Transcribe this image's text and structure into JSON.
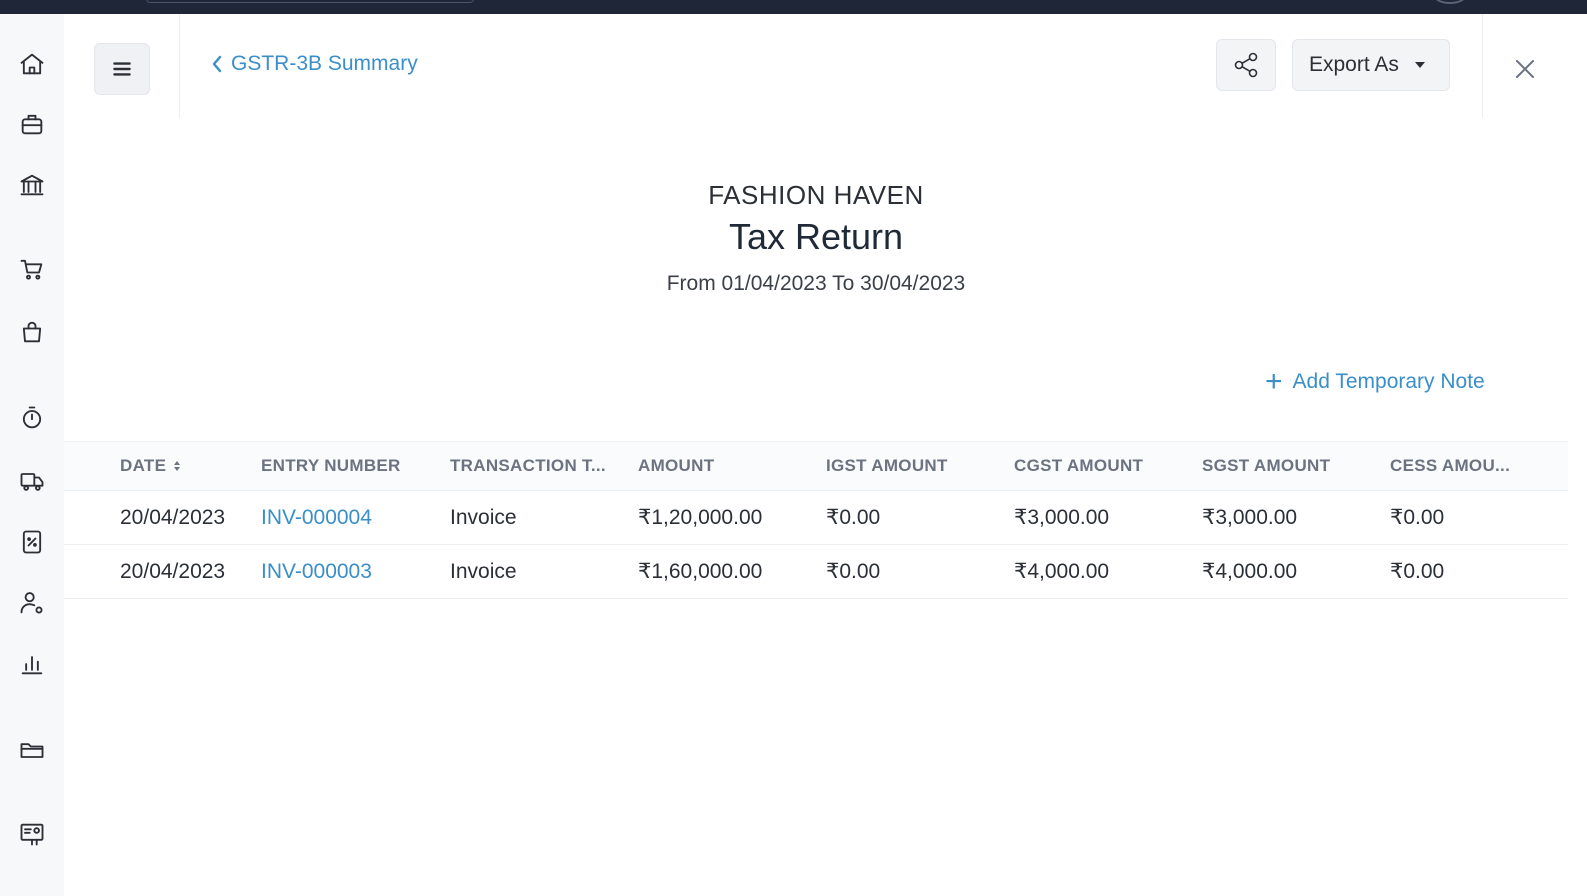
{
  "header": {
    "back_label": "GSTR-3B Summary",
    "export_label": "Export As"
  },
  "sidebar": {
    "icons": [
      "home-icon",
      "briefcase-icon",
      "bank-icon",
      "cart-icon",
      "shopping-bag-icon",
      "timer-icon",
      "delivery-truck-icon",
      "tax-document-icon",
      "user-settings-icon",
      "bar-chart-icon",
      "folder-icon",
      "settings-card-icon"
    ]
  },
  "report": {
    "company": "FASHION HAVEN",
    "title": "Tax Return",
    "period": "From 01/04/2023 To 30/04/2023",
    "add_note_label": "Add Temporary Note"
  },
  "table": {
    "columns": [
      "DATE",
      "ENTRY NUMBER",
      "TRANSACTION T...",
      "AMOUNT",
      "IGST AMOUNT",
      "CGST AMOUNT",
      "SGST AMOUNT",
      "CESS AMOU..."
    ],
    "rows": [
      [
        "20/04/2023",
        "INV-000004",
        "Invoice",
        "₹1,20,000.00",
        "₹0.00",
        "₹3,000.00",
        "₹3,000.00",
        "₹0.00"
      ],
      [
        "20/04/2023",
        "INV-000003",
        "Invoice",
        "₹1,60,000.00",
        "₹0.00",
        "₹4,000.00",
        "₹4,000.00",
        "₹0.00"
      ]
    ]
  },
  "colors": {
    "link": "#3a8fc9",
    "topbar": "#1f2638",
    "rail": "#f7f8fa"
  }
}
